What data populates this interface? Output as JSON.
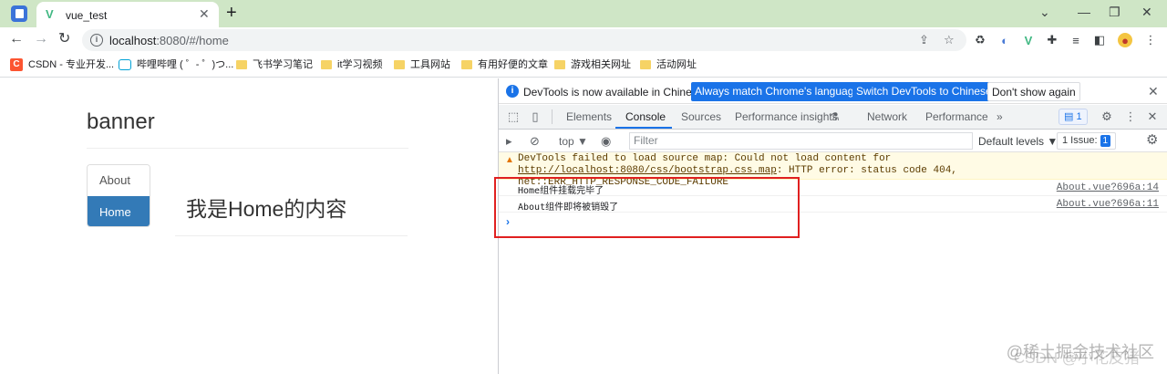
{
  "browser": {
    "tab_title": "vue_test",
    "new_tab": "+",
    "url_host": "localhost",
    "url_rest": ":8080/#/home",
    "window_controls": [
      "⌄",
      "—",
      "❐",
      "✕"
    ]
  },
  "bookmarks": [
    {
      "label": "CSDN - 专业开发...",
      "icon": "csdn-logo"
    },
    {
      "label": "哔哩哔哩 ( ゜- ゜)つ...",
      "icon": "bilibili-logo"
    },
    {
      "label": "飞书学习笔记",
      "icon": "folder-icon"
    },
    {
      "label": "it学习视频",
      "icon": "folder-icon"
    },
    {
      "label": "工具网站",
      "icon": "folder-icon"
    },
    {
      "label": "有用好便的文章",
      "icon": "folder-icon"
    },
    {
      "label": "游戏相关网址",
      "icon": "folder-icon"
    },
    {
      "label": "活动网址",
      "icon": "folder-icon"
    }
  ],
  "page": {
    "banner": "banner",
    "nav": [
      {
        "label": "About",
        "active": false
      },
      {
        "label": "Home",
        "active": true
      }
    ],
    "content": "我是Home的内容"
  },
  "devtools": {
    "infobar": {
      "message": "DevTools is now available in Chinese!",
      "btn_match": "Always match Chrome's language",
      "btn_switch": "Switch DevTools to Chinese",
      "btn_dismiss": "Don't show again"
    },
    "tabs": [
      "Elements",
      "Console",
      "Sources",
      "Performance insights",
      "Network",
      "Performance"
    ],
    "active_tab": "Console",
    "more_tabs": "»",
    "messages_badge": "1",
    "console_toolbar": {
      "context": "top ▼",
      "filter_placeholder": "Filter",
      "levels": "Default levels ▼",
      "issues_label": "1 Issue:",
      "issues_count": "1"
    },
    "warning": {
      "text_before": "DevTools failed to load source map: Could not load content for ",
      "link": "http://localhost:8080/css/bootstrap.css.map",
      "text_after": ": HTTP error: status code 404, net::ERR_HTTP_RESPONSE_CODE_FAILURE"
    },
    "logs": [
      {
        "message": "Home组件挂载完毕了",
        "source": "About.vue?696a:14"
      },
      {
        "message": "About组件即将被销毁了",
        "source": "About.vue?696a:11"
      }
    ],
    "prompt": "›"
  },
  "watermark": "@稀土掘金技术社区",
  "watermark2": "CSDN @小花皮猪",
  "colors": {
    "tabstrip": "#cfe6c6",
    "active_nav": "#337ab7",
    "accent": "#1a73e8",
    "highlight_box": "#e02020"
  }
}
